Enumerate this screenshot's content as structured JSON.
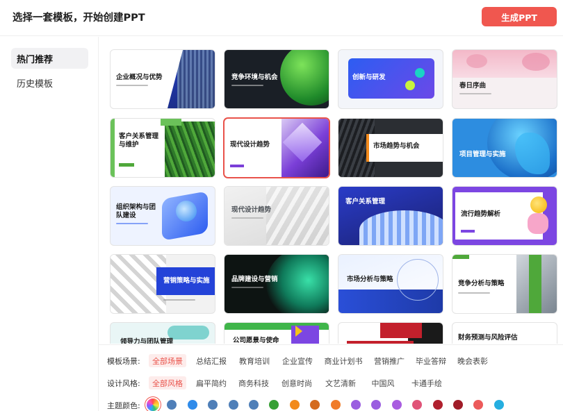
{
  "header": {
    "title": "选择一套模板，开始创建PPT",
    "generate_label": "生成PPT"
  },
  "sidebar": {
    "items": [
      {
        "label": "热门推荐",
        "active": true
      },
      {
        "label": "历史模板",
        "active": false
      }
    ]
  },
  "templates": [
    {
      "title": "企业概况与优势",
      "theme": "blue-skyscraper"
    },
    {
      "title": "竞争环境与机会",
      "theme": "dark-green-orb"
    },
    {
      "title": "创新与研发",
      "theme": "blue-3d-ui"
    },
    {
      "title": "春日序曲",
      "theme": "cherry-blossom"
    },
    {
      "title": "客户关系管理\n与维护",
      "theme": "green-leaves"
    },
    {
      "title": "现代设计趋势",
      "theme": "purple-glass",
      "selected": true
    },
    {
      "title": "市场趋势与机会",
      "theme": "dark-orange-architecture"
    },
    {
      "title": "项目管理与实施",
      "theme": "blue-wave"
    },
    {
      "title": "组织架构与团\n队建设",
      "theme": "blue-3d-button"
    },
    {
      "title": "现代设计趋势",
      "theme": "grey-minimal"
    },
    {
      "title": "客户关系管理",
      "theme": "blue-dark-3d"
    },
    {
      "title": "流行趋势解析",
      "theme": "purple-emoji"
    },
    {
      "title": "营销策略与实施",
      "theme": "white-knot-blue"
    },
    {
      "title": "品牌建设与营销",
      "theme": "dark-teal-glow"
    },
    {
      "title": "市场分析与策略",
      "theme": "network-blue"
    },
    {
      "title": "竞争分析与策略",
      "theme": "green-building"
    },
    {
      "title": "领导力与团队管理",
      "theme": "teal-light"
    },
    {
      "title": "公司愿景与使命",
      "theme": "green-purple-geo"
    },
    {
      "title": "",
      "theme": "red-dark"
    },
    {
      "title": "财务预测与风险评估",
      "theme": "white-plain"
    }
  ],
  "filters": {
    "scene": {
      "label": "模板场景:",
      "options": [
        "全部场景",
        "总结汇报",
        "教育培训",
        "企业宣传",
        "商业计划书",
        "营销推广",
        "毕业答辩",
        "晚会表彰"
      ],
      "selected": "全部场景"
    },
    "style": {
      "label": "设计风格:",
      "options": [
        "全部风格",
        "扁平简约",
        "商务科技",
        "创意时尚",
        "文艺清新",
        "中国风",
        "卡通手绘"
      ],
      "selected": "全部风格"
    },
    "color": {
      "label": "主题颜色:",
      "swatches": [
        "rainbow",
        "#4f7fb8",
        "#2f8bea",
        "#4f7fb8",
        "#4f7fb8",
        "#4f7fb8",
        "#37a035",
        "#f28a1c",
        "#d46b1f",
        "#f07c2a",
        "#9a5ee0",
        "#9a5ee0",
        "#a95de0",
        "#e05478",
        "#b0202e",
        "#a01c28",
        "#ec5a5a",
        "#25aee0"
      ]
    }
  }
}
